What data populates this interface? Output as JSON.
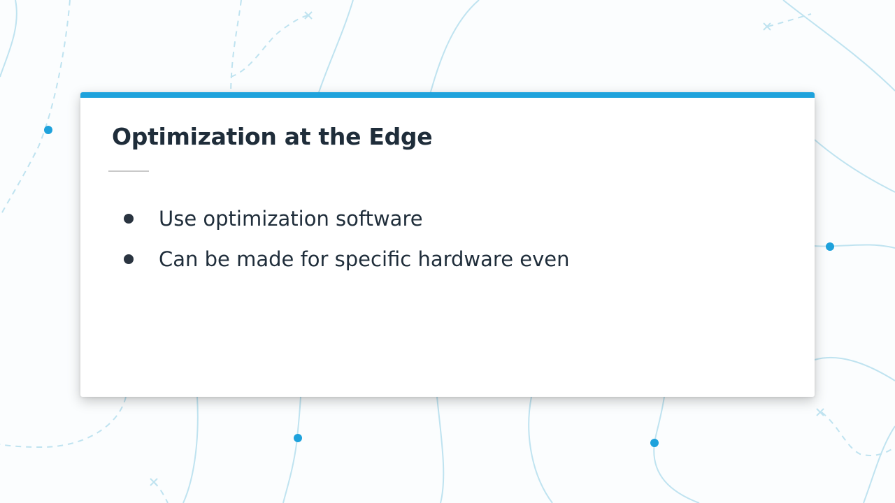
{
  "colors": {
    "accent": "#1ea2dc",
    "title": "#1f2d3a",
    "decor_line": "#bfe3f0",
    "decor_dot": "#1ea2dc",
    "underline": "#c9c9c9"
  },
  "slide": {
    "title": "Optimization at the Edge",
    "bullets": [
      "Use optimization software",
      "Can be made for specific hardware even"
    ]
  }
}
